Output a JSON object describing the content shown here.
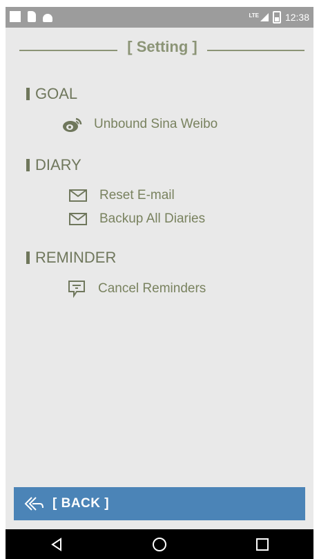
{
  "status_bar": {
    "time": "12:38",
    "network": "LTE",
    "icons": [
      "notification-square-icon",
      "sd-card-icon",
      "android-icon",
      "signal-icon",
      "battery-icon"
    ]
  },
  "header": {
    "title": "[ Setting ]"
  },
  "sections": {
    "goal": {
      "label": "GOAL",
      "items": [
        {
          "label": "Unbound Sina Weibo",
          "icon": "weibo-icon"
        }
      ]
    },
    "diary": {
      "label": "DIARY",
      "items": [
        {
          "label": "Reset E-mail",
          "icon": "mail-icon"
        },
        {
          "label": "Backup All Diaries",
          "icon": "mail-icon"
        }
      ]
    },
    "reminder": {
      "label": "REMINDER",
      "items": [
        {
          "label": "Cancel Reminders",
          "icon": "message-icon"
        }
      ]
    }
  },
  "back_button": {
    "label": "[ BACK ]",
    "icon": "back-arrow-icon"
  },
  "nav_bar": {
    "icons": [
      "nav-back-icon",
      "nav-home-icon",
      "nav-recents-icon"
    ]
  },
  "colors": {
    "background": "#e9e9e9",
    "accent_text": "#8b9476",
    "section_text": "#6f775c",
    "item_text": "#79825f",
    "back_bar": "#4b84b7",
    "status_bar": "#9c9c9c",
    "nav_bar": "#000000"
  }
}
